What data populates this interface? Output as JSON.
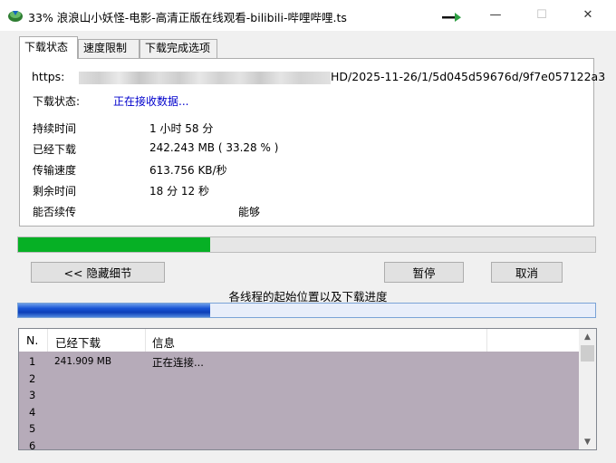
{
  "window": {
    "title": "33% 浪浪山小妖怪-电影-高清正版在线观看-bilibili-哔哩哔哩.ts",
    "minimize": "—",
    "maximize": "☐",
    "close": "✕",
    "icon": "app-download-icon"
  },
  "tabs": [
    {
      "label": "下载状态",
      "active": true
    },
    {
      "label": "速度限制",
      "active": false
    },
    {
      "label": "下载完成选项",
      "active": false
    }
  ],
  "status": {
    "url_prefix": "https:",
    "url_suffix": "HD/2025-11-26/1/5d045d59676d/9f7e057122a3",
    "status_label": "下载状态:",
    "status_value": "正在接收数据...",
    "duration_label": "持续时间",
    "duration_value": "1 小时 58 分",
    "downloaded_label": "已经下载",
    "downloaded_value": "242.243  MB ( 33.28 % )",
    "speed_label": "传输速度",
    "speed_value": "613.756  KB/秒",
    "remaining_label": "剩余时间",
    "remaining_value": "18 分 12 秒",
    "resume_label": "能否续传",
    "resume_value": "能够"
  },
  "progress": {
    "percent": 33.28,
    "color": "#06b025"
  },
  "buttons": {
    "hide_details": "<< 隐藏细节",
    "pause": "暂停",
    "cancel": "取消"
  },
  "threads_caption": "各线程的起始位置以及下载进度",
  "thread_progress": {
    "percent": 33.28
  },
  "list": {
    "columns": [
      "N.",
      "已经下载",
      "信息"
    ],
    "rows": [
      {
        "no": "1",
        "downloaded": "241.909  MB",
        "info": "正在连接..."
      },
      {
        "no": "2",
        "downloaded": "",
        "info": ""
      },
      {
        "no": "3",
        "downloaded": "",
        "info": ""
      },
      {
        "no": "4",
        "downloaded": "",
        "info": ""
      },
      {
        "no": "5",
        "downloaded": "",
        "info": ""
      },
      {
        "no": "6",
        "downloaded": "",
        "info": ""
      }
    ],
    "scroll_up": "▲",
    "scroll_down": "▼"
  }
}
